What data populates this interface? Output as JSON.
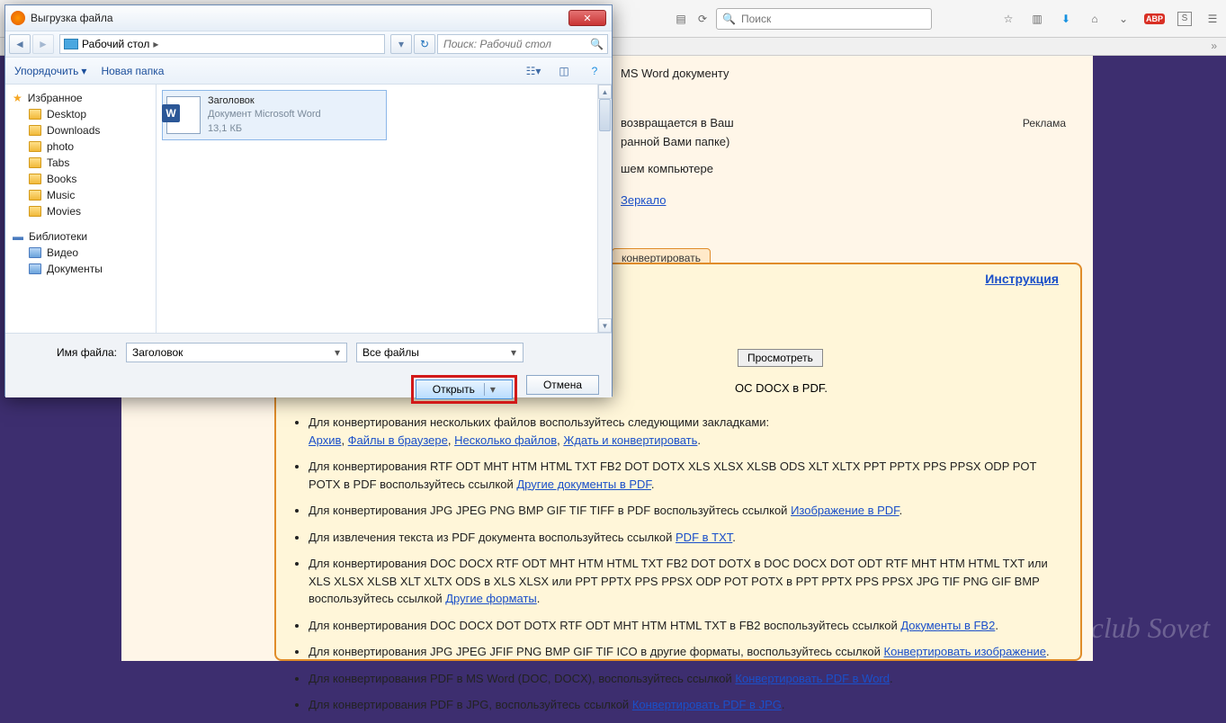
{
  "browser": {
    "search_placeholder": "Поиск",
    "icons": [
      "star",
      "clipboard",
      "download",
      "home",
      "pocket",
      "abp",
      "script",
      "menu"
    ]
  },
  "page": {
    "ad_label": "Реклама",
    "top_line": "MS Word документу",
    "para1a": "возвращается в Ваш",
    "para1b": "ранной Вами папке)",
    "para2": "шем компьютере",
    "mirror": "Зеркало",
    "convert_tab": "конвертировать",
    "instruction": "Инструкция",
    "browse": "Просмотреть",
    "panel_heading": "OC DOCX в PDF.",
    "bullets": [
      {
        "pre": "Для конвертирования нескольких файлов воспользуйтесь следующими закладками:",
        "links": [
          "Архив",
          "Файлы в браузере",
          "Несколько файлов",
          "Ждать и конвертировать"
        ],
        "sep": ", ",
        "post": "."
      },
      {
        "pre": "Для конвертирования RTF ODT MHT HTM HTML TXT FB2 DOT DOTX XLS XLSX XLSB ODS XLT XLTX PPT PPTX PPS PPSX ODP POT POTX в PDF воспользуйтесь ссылкой ",
        "links": [
          "Другие документы в PDF"
        ],
        "post": "."
      },
      {
        "pre": "Для конвертирования JPG JPEG PNG BMP GIF TIF TIFF в PDF воспользуйтесь ссылкой ",
        "links": [
          "Изображение в PDF"
        ],
        "post": "."
      },
      {
        "pre": "Для извлечения текста из PDF документа воспользуйтесь ссылкой ",
        "links": [
          "PDF в TXT"
        ],
        "post": "."
      },
      {
        "pre": "Для конвертирования DOC DOCX RTF ODT MHT HTM HTML TXT FB2 DOT DOTX в DOC DOCX DOT ODT RTF MHT HTM HTML TXT или XLS XLSX XLSB XLT XLTX ODS в XLS XLSX или PPT PPTX PPS PPSX ODP POT POTX в PPT PPTX PPS PPSX JPG TIF PNG GIF BMP воспользуйтесь ссылкой ",
        "links": [
          "Другие форматы"
        ],
        "post": "."
      },
      {
        "pre": "Для конвертирования DOC DOCX DOT DOTX RTF ODT MHT HTM HTML TXT в FB2 воспользуйтесь ссылкой ",
        "links": [
          "Документы в FB2"
        ],
        "post": "."
      },
      {
        "pre": "Для конвертирования JPG JPEG JFIF PNG BMP GIF TIF ICO в другие форматы, воспользуйтесь ссылкой ",
        "links": [
          "Конвертировать изображение"
        ],
        "post": "."
      },
      {
        "pre": "Для конвертирования PDF в MS Word (DOC, DOCX), воспользуйтесь ссылкой ",
        "links": [
          "Конвертировать PDF в Word"
        ],
        "post": "."
      },
      {
        "pre": "Для конвертирования PDF в JPG, воспользуйтесь ссылкой ",
        "links": [
          "Конвертировать PDF в JPG"
        ],
        "post": "."
      }
    ]
  },
  "dialog": {
    "title": "Выгрузка файла",
    "breadcrumb": "Рабочий стол",
    "search_placeholder": "Поиск: Рабочий стол",
    "organize": "Упорядочить",
    "new_folder": "Новая папка",
    "favorites_label": "Избранное",
    "favorites": [
      "Desktop",
      "Downloads",
      "photo",
      "Tabs",
      "Books",
      "Music",
      "Movies"
    ],
    "libraries_label": "Библиотеки",
    "libraries": [
      "Видео",
      "Документы"
    ],
    "file": {
      "name": "Заголовок",
      "type": "Документ Microsoft Word",
      "size": "13,1 КБ"
    },
    "filename_label": "Имя файла:",
    "filename_value": "Заголовок",
    "filetype_value": "Все файлы",
    "open_btn": "Открыть",
    "cancel_btn": "Отмена"
  },
  "watermark": "club Sovet"
}
